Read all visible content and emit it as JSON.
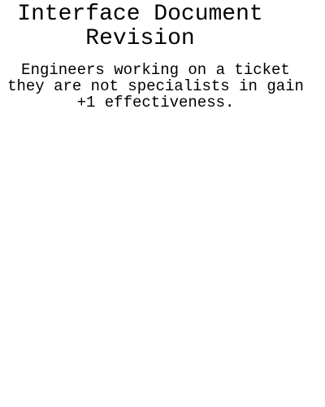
{
  "document": {
    "title": "Interface Document Revision",
    "body": "Engineers working on a ticket they are not specialists in gain +1 effectiveness."
  }
}
